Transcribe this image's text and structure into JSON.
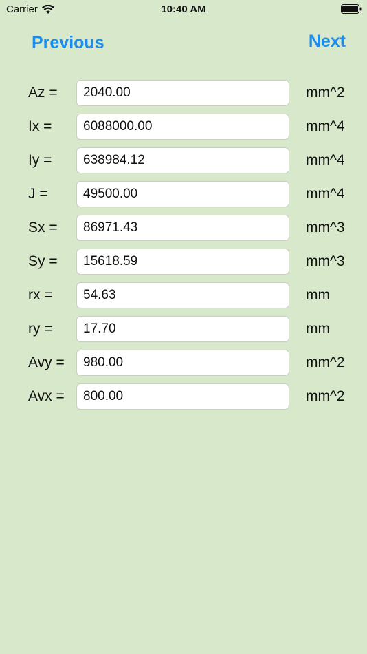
{
  "status_bar": {
    "carrier": "Carrier",
    "time": "10:40 AM",
    "wifi_icon": "wifi-icon",
    "battery_icon": "battery-icon"
  },
  "nav": {
    "previous_label": "Previous",
    "next_label": "Next",
    "accent_color": "#1a8df0"
  },
  "rows": [
    {
      "label": "Az =",
      "value": "2040.00",
      "unit": "mm^2"
    },
    {
      "label": "Ix =",
      "value": "6088000.00",
      "unit": "mm^4"
    },
    {
      "label": "Iy =",
      "value": "638984.12",
      "unit": "mm^4"
    },
    {
      "label": "J =",
      "value": "49500.00",
      "unit": "mm^4"
    },
    {
      "label": "Sx =",
      "value": "86971.43",
      "unit": "mm^3"
    },
    {
      "label": "Sy =",
      "value": "15618.59",
      "unit": "mm^3"
    },
    {
      "label": "rx =",
      "value": "54.63",
      "unit": "mm"
    },
    {
      "label": "ry =",
      "value": "17.70",
      "unit": "mm"
    },
    {
      "label": "Avy =",
      "value": "980.00",
      "unit": "mm^2"
    },
    {
      "label": "Avx =",
      "value": "800.00",
      "unit": "mm^2"
    }
  ],
  "background_color": "#d8e8cb"
}
